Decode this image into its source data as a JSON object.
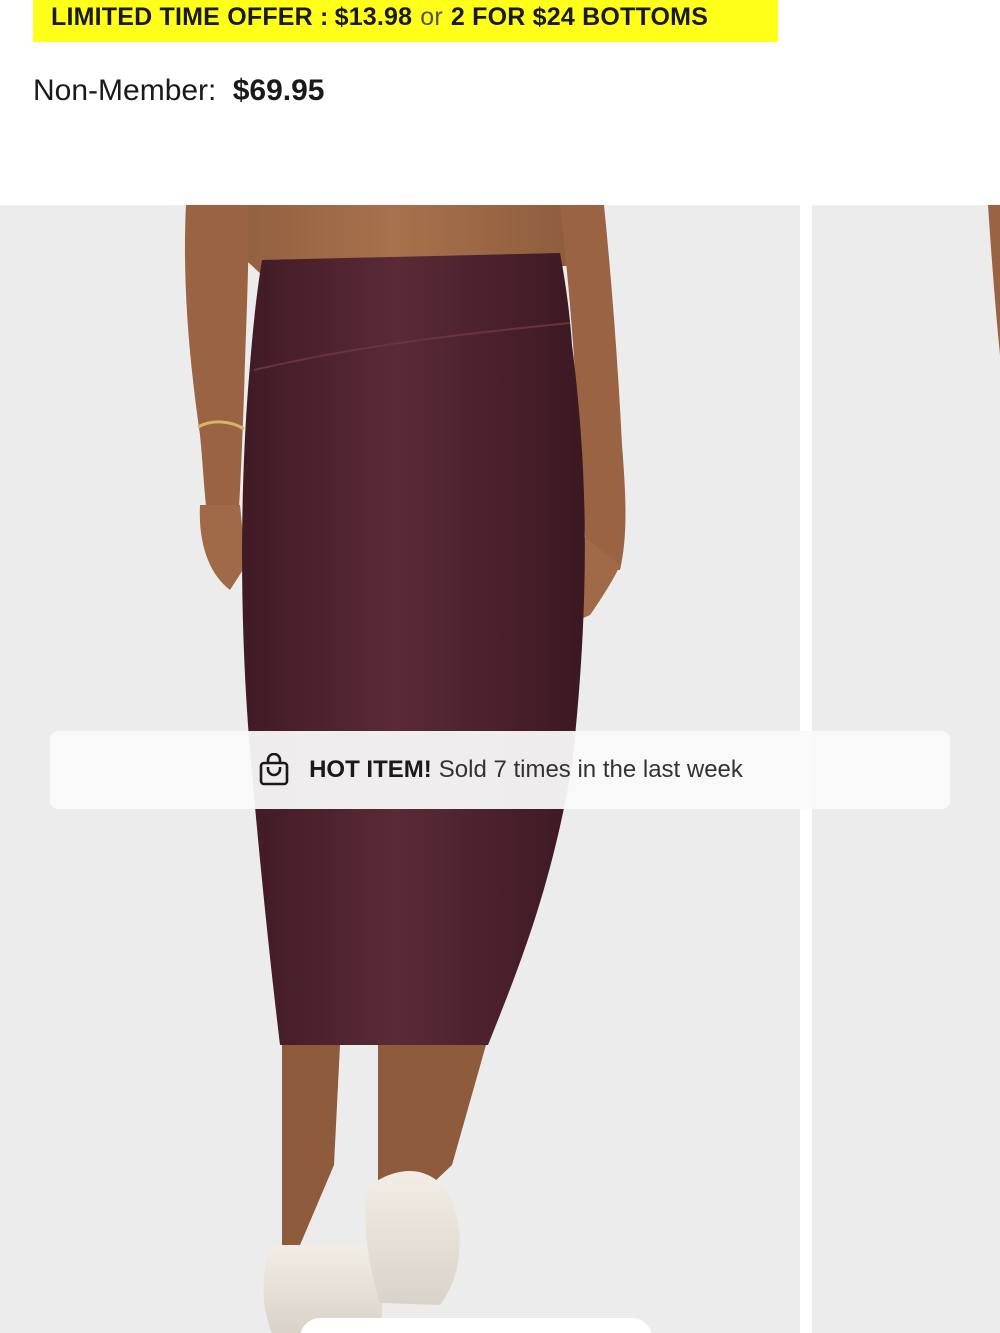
{
  "promo": {
    "label": "LIMITED TIME OFFER :",
    "price": "$13.98",
    "or": "or",
    "deal": "2 FOR $24 BOTTOMS",
    "background_color": "#ffff1a"
  },
  "pricing": {
    "label": "Non-Member:",
    "value": "$69.95"
  },
  "gallery": {
    "main_image": {
      "description_icon": "product-photo-skirt",
      "skirt_color": "#4f2430",
      "background_color": "#ececec"
    },
    "next_image": {
      "description_icon": "product-photo-next"
    }
  },
  "hot_item": {
    "icon": "shopping-bag-icon",
    "strong_text": "HOT ITEM!",
    "text": "Sold 7 times in the last week"
  }
}
